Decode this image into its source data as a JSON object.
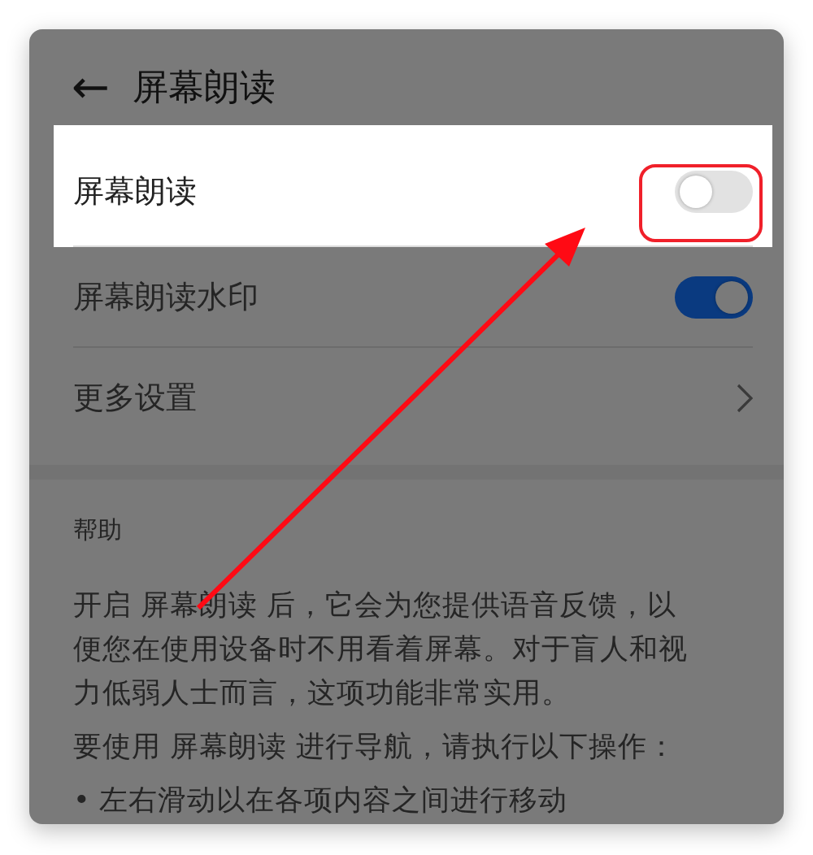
{
  "header": {
    "back": "←",
    "title": "屏幕朗读"
  },
  "settings": [
    {
      "kind": "toggle",
      "label": "屏幕朗读",
      "on": false,
      "highlighted": true
    },
    {
      "kind": "toggle",
      "label": "屏幕朗读水印",
      "on": true,
      "highlighted": false
    },
    {
      "kind": "link",
      "label": "更多设置",
      "highlighted": false
    }
  ],
  "help": {
    "heading": "帮助",
    "paragraphs": [
      "开启 屏幕朗读 后，它会为您提供语音反馈，以便您在使用设备时不用看着屏幕。对于盲人和视力低弱人士而言，这项功能非常实用。",
      "要使用 屏幕朗读 进行导航，请执行以下操作："
    ],
    "bullets": [
      "• 左右滑动以在各项内容之间进行移动"
    ]
  }
}
